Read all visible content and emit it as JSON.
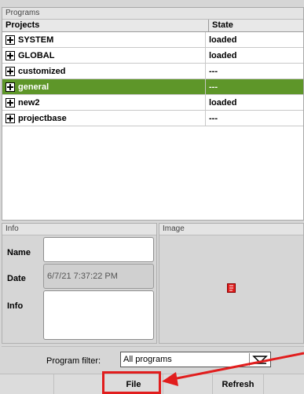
{
  "programs_panel": {
    "title": "Programs",
    "columns": {
      "projects": "Projects",
      "state": "State"
    },
    "rows": [
      {
        "name": "SYSTEM",
        "state": "loaded",
        "selected": false
      },
      {
        "name": "GLOBAL",
        "state": "loaded",
        "selected": false
      },
      {
        "name": "customized",
        "state": "---",
        "selected": false
      },
      {
        "name": "general",
        "state": "---",
        "selected": true
      },
      {
        "name": "new2",
        "state": "loaded",
        "selected": false
      },
      {
        "name": "projectbase",
        "state": "---",
        "selected": false
      }
    ]
  },
  "info_panel": {
    "title": "Info",
    "name_label": "Name",
    "name_value": "",
    "date_label": "Date",
    "date_value": "6/7/21 7:37:22 PM",
    "info_label": "Info",
    "info_value": ""
  },
  "image_panel": {
    "title": "Image",
    "placeholder_icon": "missing-image-icon"
  },
  "filter": {
    "label": "Program filter:",
    "selected": "All programs"
  },
  "buttons": {
    "file": "File",
    "refresh": "Refresh"
  },
  "colors": {
    "selection": "#5e9629",
    "annotation": "#e11d1d"
  }
}
